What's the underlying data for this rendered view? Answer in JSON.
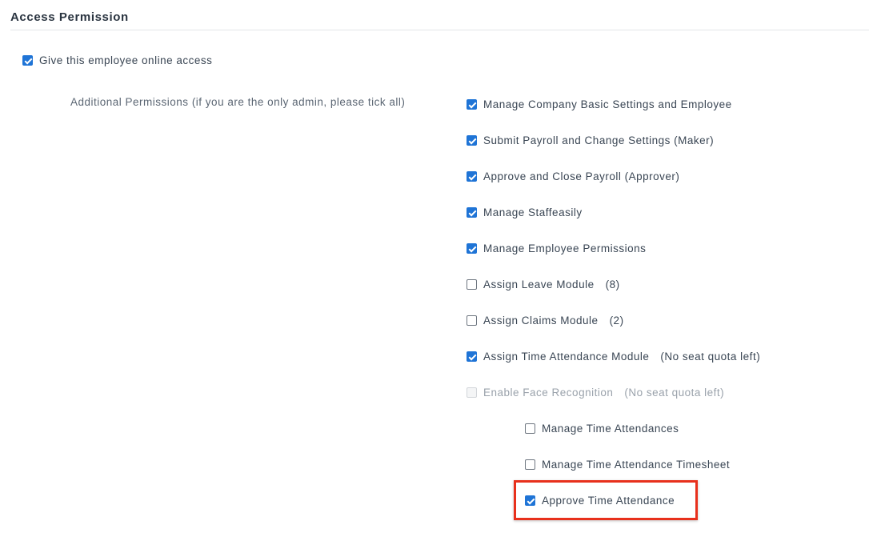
{
  "section": {
    "title": "Access Permission"
  },
  "online_access": {
    "label": "Give this employee online access",
    "checked": true
  },
  "additional": {
    "label": "Additional Permissions (if you are the only admin, please tick all)"
  },
  "permissions": [
    {
      "label": "Manage Company Basic Settings and Employee",
      "suffix": "",
      "state": "checked"
    },
    {
      "label": "Submit Payroll and Change Settings (Maker)",
      "suffix": "",
      "state": "checked"
    },
    {
      "label": "Approve and Close Payroll (Approver)",
      "suffix": "",
      "state": "checked"
    },
    {
      "label": "Manage Staffeasily",
      "suffix": "",
      "state": "checked"
    },
    {
      "label": "Manage Employee Permissions",
      "suffix": "",
      "state": "checked"
    },
    {
      "label": "Assign Leave Module",
      "suffix": "(8)",
      "state": "unchecked"
    },
    {
      "label": "Assign Claims Module",
      "suffix": "(2)",
      "state": "unchecked"
    },
    {
      "label": "Assign Time Attendance Module",
      "suffix": "(No seat quota left)",
      "state": "checked"
    },
    {
      "label": "Enable Face Recognition",
      "suffix": "(No seat quota left)",
      "state": "disabled"
    }
  ],
  "time_attendance_permissions": [
    {
      "label": "Manage Time Attendances",
      "state": "unchecked"
    },
    {
      "label": "Manage Time Attendance Timesheet",
      "state": "unchecked"
    },
    {
      "label": "Approve Time Attendance",
      "state": "checked",
      "highlighted": true
    }
  ],
  "colors": {
    "checkbox_accent": "#1f74d6",
    "highlight_border": "#e8301c"
  }
}
